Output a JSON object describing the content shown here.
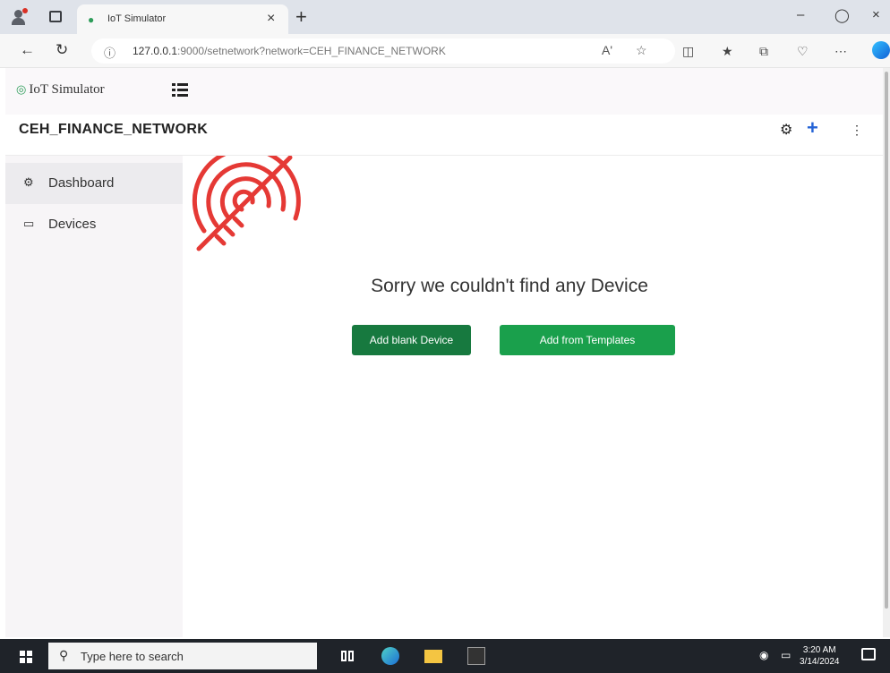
{
  "browser": {
    "tab_title": "IoT Simulator",
    "tab_favicon": "globe-icon",
    "url_host": "127.0.0.1",
    "url_rest": ":9000/setnetwork?network=CEH_FINANCE_NETWORK",
    "read_aloud": "Aʹ"
  },
  "app": {
    "brand": "IoT Simulator",
    "network_title": "CEH_FINANCE_NETWORK",
    "sidebar": {
      "items": [
        {
          "label": "Dashboard",
          "icon": "dashboard-icon",
          "active": true
        },
        {
          "label": "Devices",
          "icon": "monitor-icon",
          "active": false
        }
      ]
    },
    "empty_message": "Sorry we couldn't find any Device",
    "buttons": {
      "add_blank": "Add blank Device",
      "add_templates": "Add from Templates"
    },
    "colors": {
      "logo_red": "#e53935",
      "primary_green": "#17793f",
      "template_green": "#1aa04c",
      "accent_blue": "#2563d6"
    }
  },
  "taskbar": {
    "search_placeholder": "Type here to search",
    "time": "3:20 AM",
    "date": "3/14/2024"
  }
}
